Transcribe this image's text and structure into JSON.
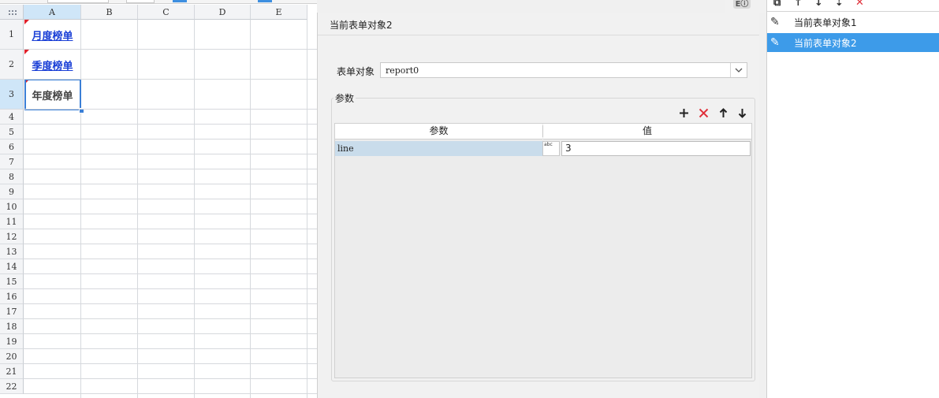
{
  "sheet": {
    "columns": [
      "A",
      "B",
      "C",
      "D",
      "E"
    ],
    "selected_column": "A",
    "rows": [
      "1",
      "2",
      "3",
      "4",
      "5",
      "6",
      "7",
      "8",
      "9",
      "10",
      "11",
      "12",
      "13",
      "14",
      "15",
      "16",
      "17",
      "18",
      "19",
      "20",
      "21",
      "22"
    ],
    "selected_row": "3",
    "cells": {
      "A1": "月度榜单",
      "A2": "季度榜单",
      "A3": "年度榜单"
    },
    "link_color": "#1a3fd6",
    "selection_color": "#3b7fd6"
  },
  "dialog": {
    "title": "当前表单对象2",
    "form_object_label": "表单对象",
    "form_object_value": "report0",
    "params_group_label": "参数",
    "table_headers": [
      "参数",
      "值"
    ],
    "rows": [
      {
        "name": "line",
        "value": "3"
      }
    ],
    "type_icon_text": "abc"
  },
  "right_panel": {
    "items": [
      {
        "label": "当前表单对象1",
        "selected": false
      },
      {
        "label": "当前表单对象2",
        "selected": true
      }
    ],
    "selected_color": "#3d9be9"
  },
  "icons": {
    "add": "+",
    "delete": "✕",
    "up": "↑",
    "down": "↓",
    "edit": "✎",
    "dropdown": "⌄"
  }
}
